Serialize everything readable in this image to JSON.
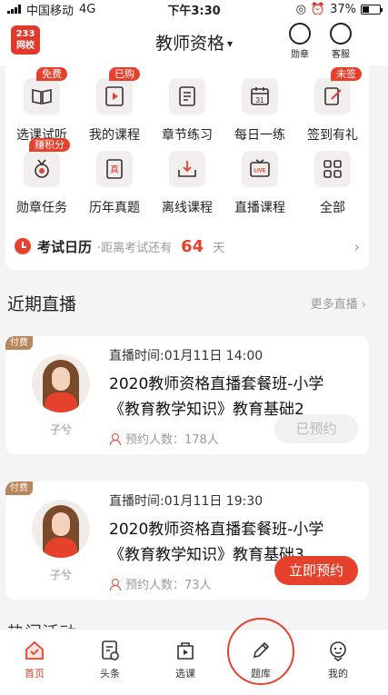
{
  "status_bar": {
    "carrier": "中国移动",
    "network": "4G",
    "time": "下午3:30",
    "battery": "37%"
  },
  "header": {
    "logo_top": "233",
    "logo_bottom": "网校",
    "title": "教师资格",
    "caret": "▾",
    "medal_label": "勋章",
    "service_label": "客服"
  },
  "grid": {
    "items": [
      {
        "label": "选课试听",
        "icon": "book-open-icon",
        "tag": "免费"
      },
      {
        "label": "我的课程",
        "icon": "play-video-icon",
        "tag": "已购"
      },
      {
        "label": "章节练习",
        "icon": "document-list-icon",
        "tag": ""
      },
      {
        "label": "每日一练",
        "icon": "calendar-icon",
        "tag": ""
      },
      {
        "label": "签到有礼",
        "icon": "sign-in-icon",
        "tag": "未签"
      },
      {
        "label": "勋章任务",
        "icon": "medal-icon",
        "tag": "赚积分"
      },
      {
        "label": "历年真题",
        "icon": "exam-paper-icon",
        "tag": ""
      },
      {
        "label": "离线课程",
        "icon": "download-tray-icon",
        "tag": ""
      },
      {
        "label": "直播课程",
        "icon": "live-tv-icon",
        "tag": ""
      },
      {
        "label": "全部",
        "icon": "grid-all-icon",
        "tag": ""
      }
    ]
  },
  "exam_calendar": {
    "title": "考试日历",
    "prefix": "·距离考试还有",
    "days": "64",
    "unit": "天",
    "arrow": "›"
  },
  "recent_live": {
    "title": "近期直播",
    "more": "更多直播 ›",
    "cards": [
      {
        "paid": "付费",
        "teacher": "子兮",
        "time": "直播时间:01月11日 14:00",
        "title_line1": "2020教师资格直播套餐班-小学",
        "title_line2": "《教育教学知识》教育基础2",
        "count": "预约人数：178人",
        "button": "已预约"
      },
      {
        "paid": "付费",
        "teacher": "子兮",
        "time": "直播时间:01月11日 19:30",
        "title_line1": "2020教师资格直播套餐班-小学",
        "title_line2": "《教育教学知识》教育基础3",
        "count": "预约人数：73人",
        "button": "立即预约"
      }
    ]
  },
  "hot_activity_peek": "热门活动",
  "tabbar": {
    "tabs": [
      {
        "label": "首页",
        "icon": "home-icon"
      },
      {
        "label": "头条",
        "icon": "headline-icon"
      },
      {
        "label": "选课",
        "icon": "course-select-icon"
      },
      {
        "label": "题库",
        "icon": "pencil-icon"
      },
      {
        "label": "我的",
        "icon": "profile-icon"
      }
    ]
  },
  "colors": {
    "accent": "#e5412d",
    "paid_tag": "#b8865a",
    "muted": "#999999"
  }
}
